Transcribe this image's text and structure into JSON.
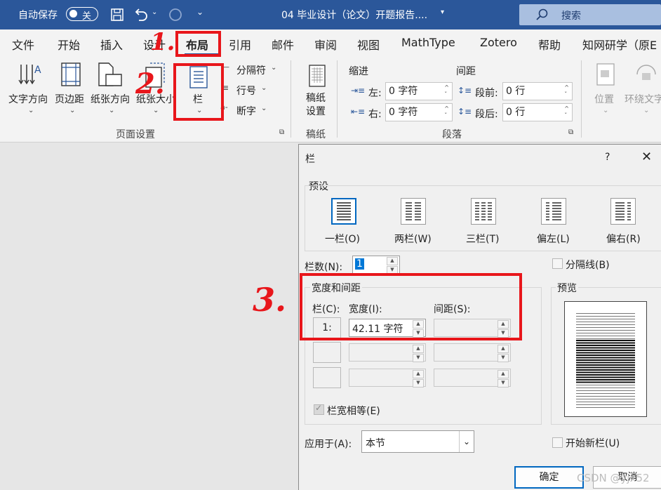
{
  "titlebar": {
    "autosave_label": "自动保存",
    "autosave_state": "关",
    "doc_title": "04 毕业设计（论文）开题报告....",
    "search_label": "搜索"
  },
  "tabs": [
    "文件",
    "开始",
    "插入",
    "设计",
    "布局",
    "引用",
    "邮件",
    "审阅",
    "视图",
    "MathType",
    "Zotero",
    "帮助",
    "知网研学（原E"
  ],
  "ribbon": {
    "text_direction": "文字方向",
    "margins": "页边距",
    "orientation": "纸张方向",
    "size": "纸张大小",
    "columns": "栏",
    "breaks": "分隔符",
    "line_numbers": "行号",
    "hyphenation": "断字",
    "page_setup_group": "页面设置",
    "draft_paper": "稿纸",
    "draft_paper_settings": "稿纸\n设置",
    "draft_group": "稿纸",
    "indent_label": "缩进",
    "spacing_label": "间距",
    "indent_left_label": "左:",
    "indent_left_value": "0 字符",
    "indent_right_label": "右:",
    "indent_right_value": "0 字符",
    "spacing_before_label": "段前:",
    "spacing_before_value": "0 行",
    "spacing_after_label": "段后:",
    "spacing_after_value": "0 行",
    "paragraph_group": "段落",
    "position": "位置",
    "wrap_text": "环绕文字"
  },
  "dialog": {
    "title": "栏",
    "help": "?",
    "close": "✕",
    "presets_label": "预设",
    "presets": [
      "一栏(O)",
      "两栏(W)",
      "三栏(T)",
      "偏左(L)",
      "偏右(R)"
    ],
    "num_columns_label": "栏数(N):",
    "num_columns_value": "1",
    "line_between_label": "分隔线(B)",
    "width_spacing_label": "宽度和间距",
    "col_header": "栏(C):",
    "width_header": "宽度(I):",
    "spacing_header": "间距(S):",
    "row1_col": "1:",
    "row1_width": "42.11 字符",
    "equal_width_label": "栏宽相等(E)",
    "preview_label": "预览",
    "apply_to_label": "应用于(A):",
    "apply_to_value": "本节",
    "start_new_column_label": "开始新栏(U)",
    "ok": "确定",
    "cancel": "取消"
  },
  "annotations": [
    "1.",
    "2.",
    "3."
  ],
  "watermark": "CSDN @yjx52"
}
